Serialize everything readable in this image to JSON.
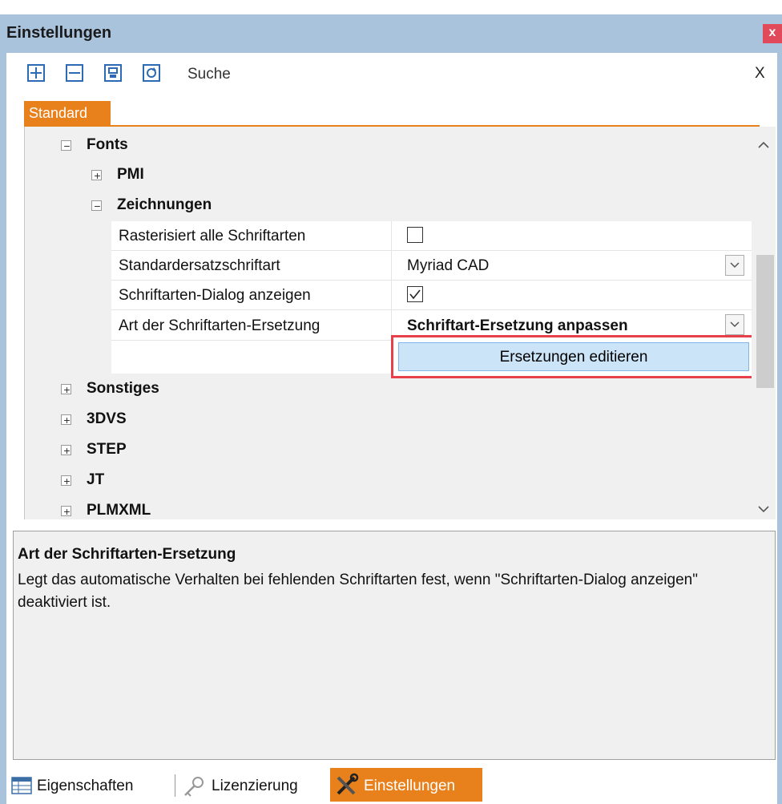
{
  "window": {
    "title": "Einstellungen",
    "close_glyph": "x"
  },
  "toolbar": {
    "icons": [
      "expand-all-icon",
      "collapse-all-icon",
      "save-icon",
      "refresh-icon"
    ],
    "search_label": "Suche",
    "clear_label": "X"
  },
  "tabs": {
    "active": "Standard"
  },
  "tree": {
    "fonts": "Fonts",
    "pmi": "PMI",
    "zeichnungen": "Zeichnungen",
    "properties": [
      {
        "label": "Rasterisiert alle Schriftarten",
        "type": "checkbox",
        "checked": false
      },
      {
        "label": "Standardersatzschriftart",
        "type": "dropdown",
        "value": "Myriad CAD"
      },
      {
        "label": "Schriftarten-Dialog anzeigen",
        "type": "checkbox",
        "checked": true
      },
      {
        "label": "Art der Schriftarten-Ersetzung",
        "type": "dropdown",
        "value": "Schriftart-Ersetzung anpassen"
      }
    ],
    "edit_button": "Ersetzungen editieren",
    "sonstiges": "Sonstiges",
    "dvs": "3DVS",
    "step": "STEP",
    "jt": "JT",
    "plmxml": "PLMXML",
    "expander_plus": "+",
    "expander_minus": "−"
  },
  "description": {
    "title": "Art der Schriftarten-Ersetzung",
    "text": "Legt das automatische Verhalten bei fehlenden Schriftarten fest, wenn \"Schriftarten-Dialog anzeigen\" deaktiviert ist."
  },
  "bottom_tabs": [
    {
      "label": "Eigenschaften",
      "icon": "table-icon",
      "active": false
    },
    {
      "label": "Lizenzierung",
      "icon": "key-icon",
      "active": false
    },
    {
      "label": "Einstellungen",
      "icon": "tools-icon",
      "active": true
    }
  ],
  "colors": {
    "title_bar": "#a9c3dd",
    "accent": "#e8801c",
    "highlight_border": "#e8404a",
    "button_fill": "#cce4f7"
  }
}
